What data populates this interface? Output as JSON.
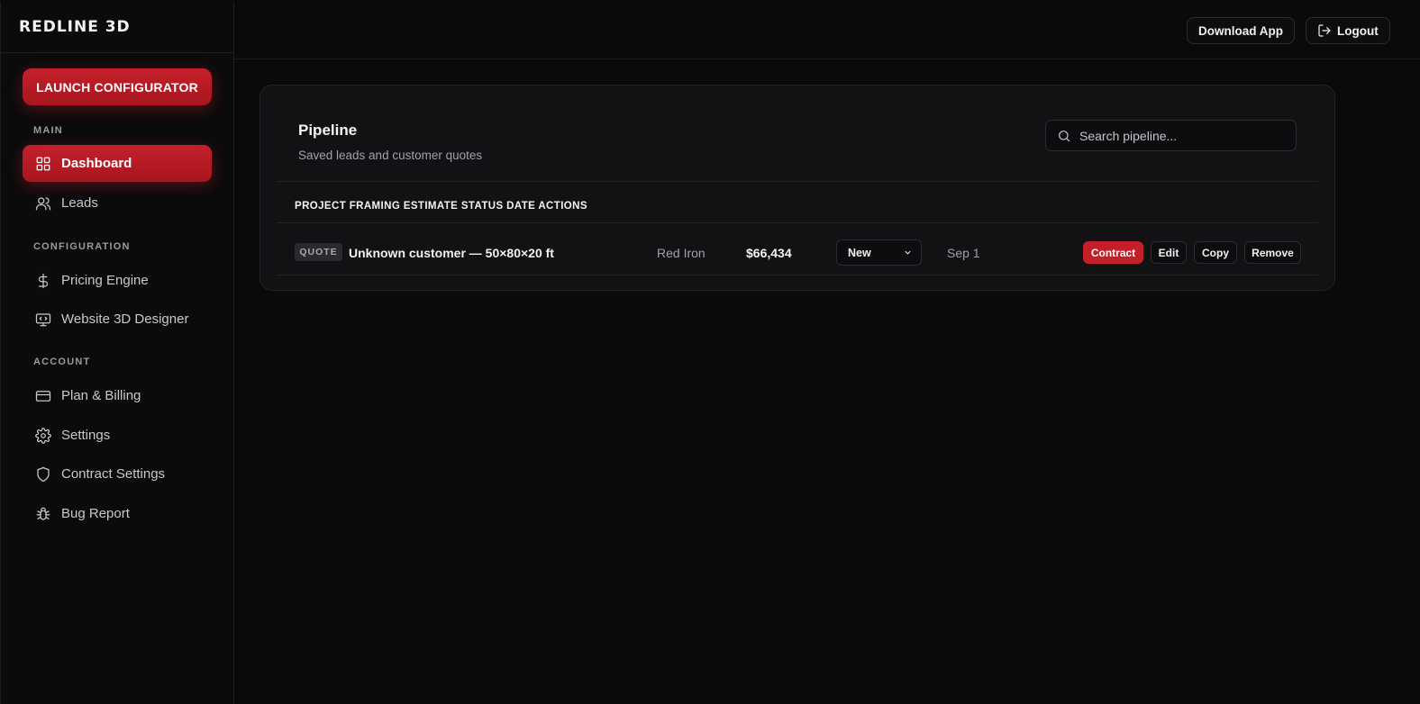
{
  "app": {
    "brand": "REDLINE 3D"
  },
  "sidebar": {
    "launch_label": "LAUNCH CONFIGURATOR",
    "sections": {
      "main": "MAIN",
      "configuration": "CONFIGURATION",
      "account": "ACCOUNT"
    },
    "items": [
      {
        "label": "Dashboard",
        "icon": "grid-icon",
        "active": true
      },
      {
        "label": "Leads",
        "icon": "users-icon"
      },
      {
        "label": "Pricing Engine",
        "icon": "dollar-icon"
      },
      {
        "label": "Website 3D Designer",
        "icon": "monitor-code-icon"
      },
      {
        "label": "Plan & Billing",
        "icon": "credit-card-icon"
      },
      {
        "label": "Settings",
        "icon": "gear-icon"
      },
      {
        "label": "Contract Settings",
        "icon": "shield-icon"
      },
      {
        "label": "Bug Report",
        "icon": "bug-icon"
      }
    ]
  },
  "topbar": {
    "download_label": "Download App",
    "logout_label": "Logout"
  },
  "pipeline": {
    "title": "Pipeline",
    "subtitle": "Saved leads and customer quotes",
    "search_placeholder": "Search pipeline...",
    "header_text": "PROJECT FRAMING ESTIMATE STATUS DATE ACTIONS",
    "rows": [
      {
        "badge": "QUOTE",
        "project": "Unknown customer — 50×80×20 ft",
        "framing": "Red Iron",
        "estimate": "$66,434",
        "status": "New",
        "date": "Sep 1",
        "actions": {
          "contract": "Contract",
          "edit": "Edit",
          "copy": "Copy",
          "remove": "Remove"
        }
      }
    ]
  },
  "colors": {
    "accent": "#c41e28",
    "background": "#0a0a0b",
    "card": "#121215"
  }
}
